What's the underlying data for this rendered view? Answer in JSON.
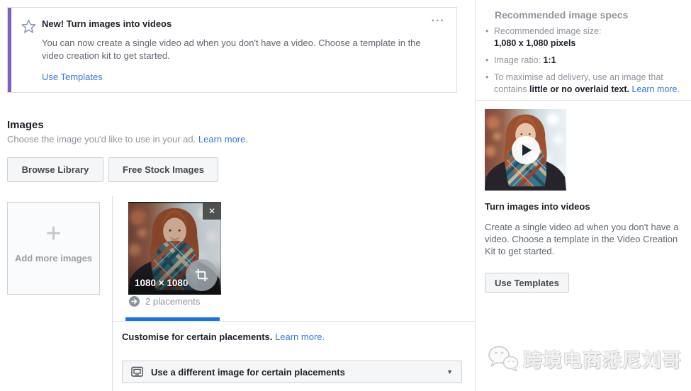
{
  "colors": {
    "link-blue": "#3578e5",
    "tab-blue": "#1b74e4",
    "banner-purple": "#7e60bf"
  },
  "banner": {
    "title": "New! Turn images into videos",
    "body": "You can now create a single video ad when you don't have a video. Choose a template in the video creation kit to get started.",
    "link_label": "Use Templates",
    "menu_icon": "..."
  },
  "images_section": {
    "title": "Images",
    "subtitle": "Choose the image you'd like to use in your ad.",
    "learn_more_label": "Learn more.",
    "browse_library_label": "Browse Library",
    "free_stock_label": "Free Stock Images",
    "add_more_label": "Add more images",
    "plus_icon": "+",
    "thumbnail": {
      "size_label": "1080 × 1080",
      "close_icon": "✕",
      "placements_label": "2 placements"
    },
    "customise_label": "Customise for certain placements.",
    "customise_learn_more": "Learn more.",
    "dropdown_label": "Use a different image for certain placements",
    "caret_icon": "▼"
  },
  "sidebar": {
    "specs_title": "Recommended image specs",
    "bullets": [
      {
        "text": "Recommended image size:",
        "bold": "1,080 x 1,080 pixels",
        "link": ""
      },
      {
        "text": "Image ratio: ",
        "bold": "1:1",
        "link": ""
      },
      {
        "text": "To maximise ad delivery, use an image that contains ",
        "bold": "little or no overlaid text.",
        "link": "Learn more."
      }
    ],
    "video_card": {
      "title": "Turn images into videos",
      "body": "Create a single video ad when you don't have a video. Choose a template in the Video Creation Kit to get started.",
      "button_label": "Use Templates"
    }
  },
  "watermark": {
    "text": "跨境电商悉尼刘哥"
  }
}
